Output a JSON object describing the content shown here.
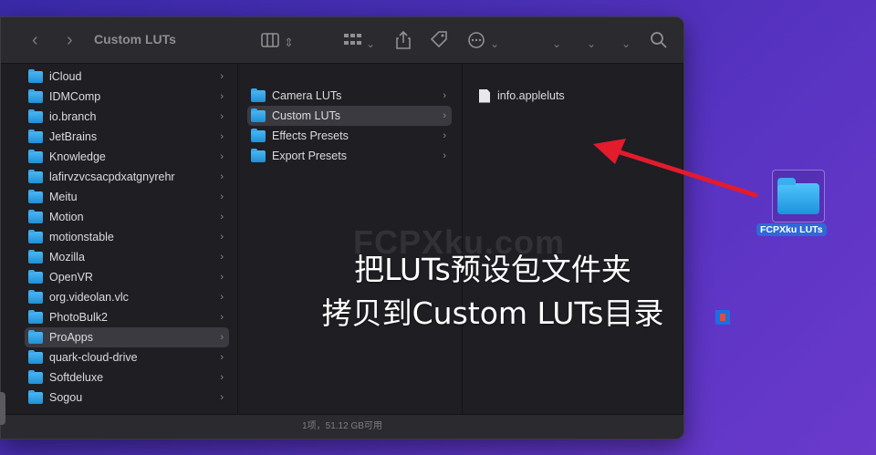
{
  "window": {
    "title": "Custom LUTs",
    "status": "1项，51.12 GB可用"
  },
  "sidebar": {
    "items": [
      {
        "label": "iCloud"
      },
      {
        "label": "IDMComp"
      },
      {
        "label": "io.branch"
      },
      {
        "label": "JetBrains"
      },
      {
        "label": "Knowledge"
      },
      {
        "label": "lafirvzvcsacpdxatgnyrehr"
      },
      {
        "label": "Meitu"
      },
      {
        "label": "Motion"
      },
      {
        "label": "motionstable"
      },
      {
        "label": "Mozilla"
      },
      {
        "label": "OpenVR"
      },
      {
        "label": "org.videolan.vlc"
      },
      {
        "label": "PhotoBulk2"
      },
      {
        "label": "ProApps",
        "selected": true
      },
      {
        "label": "quark-cloud-drive"
      },
      {
        "label": "Softdeluxe"
      },
      {
        "label": "Sogou"
      }
    ]
  },
  "column2": {
    "items": [
      {
        "label": "Camera LUTs"
      },
      {
        "label": "Custom LUTs",
        "selected": true
      },
      {
        "label": "Effects Presets"
      },
      {
        "label": "Export Presets"
      }
    ]
  },
  "column3": {
    "items": [
      {
        "label": "info.appleluts",
        "icon": "file-icon"
      }
    ]
  },
  "overlay": {
    "watermark": "FCPXku.com",
    "caption_line1": "把LUTs预设包文件夹",
    "caption_line2": "拷贝到Custom LUTs目录"
  },
  "desktop": {
    "folder_label": "FCPXku LUTs"
  },
  "colors": {
    "arrow": "#e21b2d",
    "folder": "#2aa3ec",
    "desktop_bg": "#4a2fb5"
  }
}
